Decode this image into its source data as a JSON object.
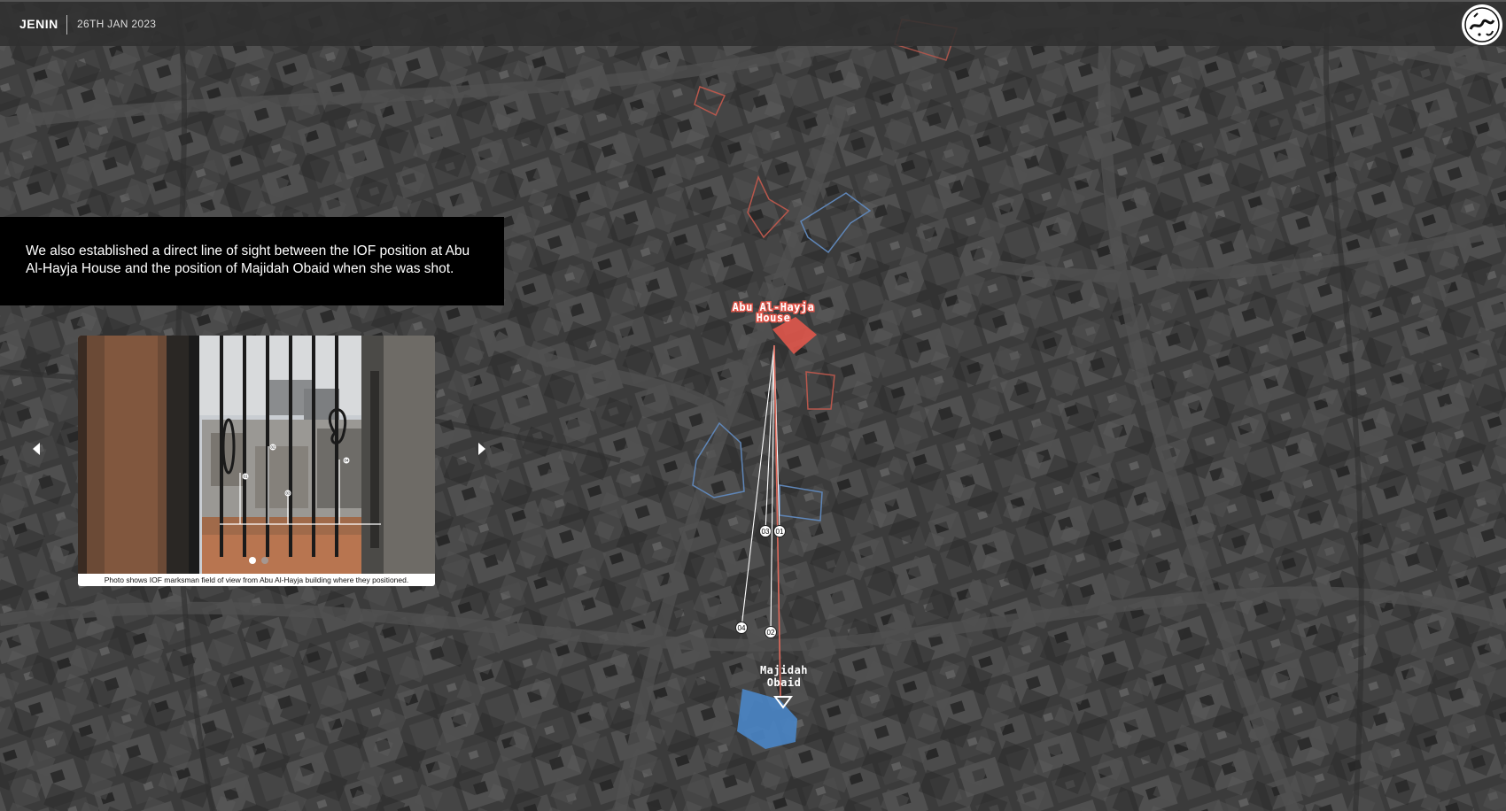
{
  "header": {
    "location": "JENIN",
    "date": "26TH JAN 2023"
  },
  "narrative": {
    "text": "We also established a direct line of sight between the IOF position at Abu Al-Hayja House and the position of Majidah Obaid when she was shot."
  },
  "photo_card": {
    "caption": "Photo shows IOF marksman field of view from Abu Al-Hayja building where they positioned.",
    "markers": [
      "01",
      "02",
      "03",
      "04"
    ],
    "slide_count": 2,
    "active_slide": 1
  },
  "map": {
    "labels": {
      "origin": [
        "Abu Al-Hayja",
        "House"
      ],
      "target": [
        "Majidah",
        "Obaid"
      ]
    },
    "sightline_markers": [
      "01",
      "02",
      "03",
      "04"
    ],
    "colors": {
      "origin": "#e0564b",
      "target": "#4a86c8",
      "sightline_primary": "#e06a5c",
      "sightlines": "#ffffff",
      "outline_red": "#b8574c",
      "outline_blue": "#5f86b8"
    }
  },
  "icons": {
    "prev": "chevron-left-icon",
    "next": "chevron-right-icon",
    "logo": "calligraphy-logo-icon",
    "target": "triangle-marker-icon"
  }
}
